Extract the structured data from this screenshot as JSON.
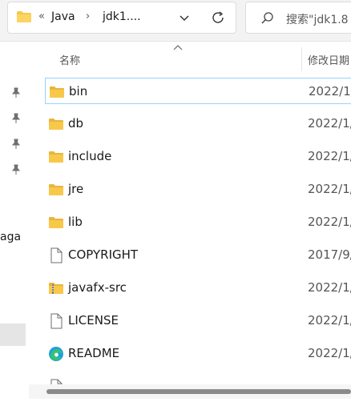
{
  "address": {
    "segments": [
      "Java",
      "jdk1...."
    ],
    "overflow_glyph": "«",
    "separator": "›"
  },
  "search": {
    "placeholder": "搜索\"jdk1.8"
  },
  "nav": {
    "partial_label": "aga"
  },
  "columns": {
    "name": "名称",
    "date": "修改日期"
  },
  "files": [
    {
      "name": "bin",
      "date": "2022/1/",
      "icon": "folder-icon"
    },
    {
      "name": "db",
      "date": "2022/1/",
      "icon": "folder-icon"
    },
    {
      "name": "include",
      "date": "2022/1/",
      "icon": "folder-icon"
    },
    {
      "name": "jre",
      "date": "2022/1/",
      "icon": "folder-icon"
    },
    {
      "name": "lib",
      "date": "2022/1/",
      "icon": "folder-icon"
    },
    {
      "name": "COPYRIGHT",
      "date": "2017/9/",
      "icon": "document-icon"
    },
    {
      "name": "javafx-src",
      "date": "2022/1/",
      "icon": "zip-folder-icon"
    },
    {
      "name": "LICENSE",
      "date": "2022/1/",
      "icon": "document-icon"
    },
    {
      "name": "README",
      "date": "2022/1/",
      "icon": "edge-browser-icon"
    }
  ],
  "colors": {
    "folder": "#f8c84a",
    "selection_border": "#99d1ff",
    "accent": "#0a64c8"
  }
}
